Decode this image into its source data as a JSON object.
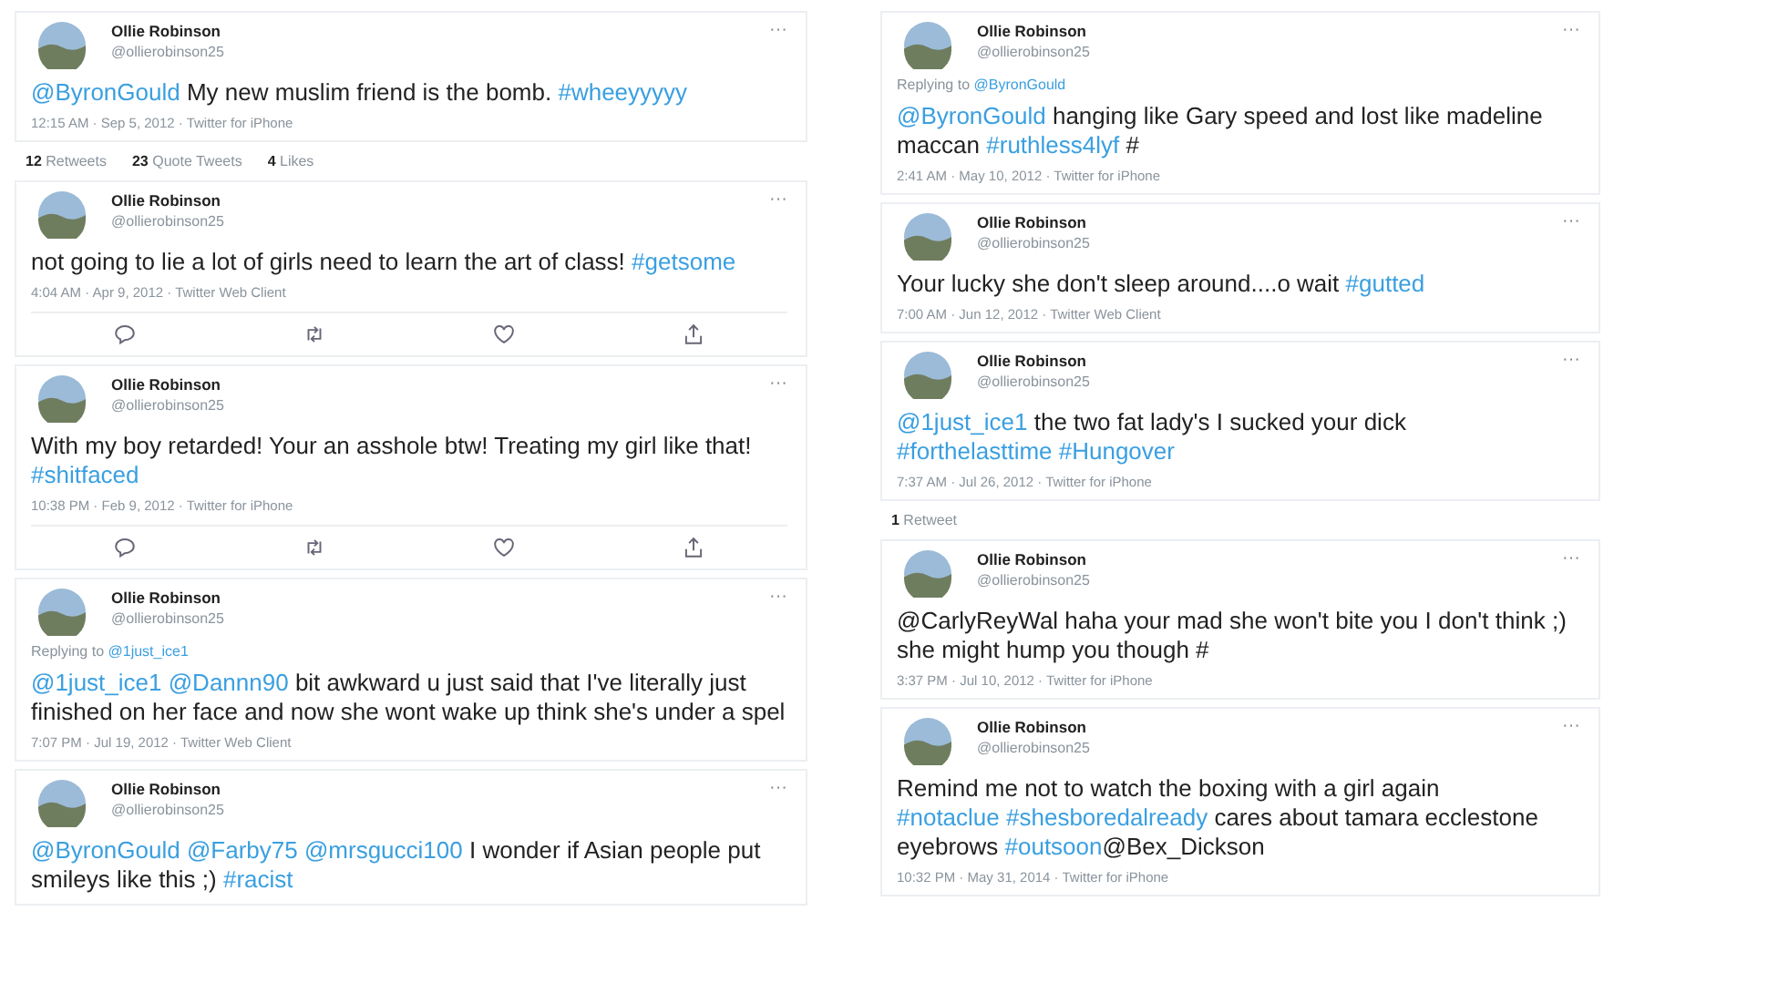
{
  "columns": [
    {
      "items": [
        {
          "kind": "tweet",
          "name": "Ollie Robinson",
          "handle": "@ollierobinson25",
          "menu": "···",
          "segments": [
            {
              "kind": "mention",
              "text": "@ByronGould"
            },
            {
              "kind": "plain",
              "text": "  My new muslim friend is the bomb. "
            },
            {
              "kind": "hashtag",
              "text": "#wheeyyyyy"
            }
          ],
          "meta": "12:15 AM · Sep 5, 2012 · Twitter for iPhone"
        },
        {
          "kind": "stats",
          "entries": [
            {
              "count": "12",
              "label": "Retweets"
            },
            {
              "count": "23",
              "label": "Quote Tweets"
            },
            {
              "count": "4",
              "label": "Likes"
            }
          ]
        },
        {
          "kind": "tweet",
          "name": "Ollie Robinson",
          "handle": "@ollierobinson25",
          "menu": "···",
          "segments": [
            {
              "kind": "plain",
              "text": "not going to lie a lot of girls need to learn the art of class! "
            },
            {
              "kind": "hashtag",
              "text": "#getsome"
            }
          ],
          "meta": "4:04 AM · Apr 9, 2012 · Twitter Web Client",
          "actions": true
        },
        {
          "kind": "tweet",
          "name": "Ollie Robinson",
          "handle": "@ollierobinson25",
          "menu": "···",
          "segments": [
            {
              "kind": "plain",
              "text": "With my boy retarded! Your an asshole btw! Treating my girl like that! "
            },
            {
              "kind": "hashtag",
              "text": "#shitfaced"
            }
          ],
          "meta": "10:38 PM · Feb 9, 2012 · Twitter for iPhone",
          "actions": true
        },
        {
          "kind": "tweet",
          "name": "Ollie Robinson",
          "handle": "@ollierobinson25",
          "menu": "···",
          "replying": {
            "label": "Replying to",
            "handle": "@1just_ice1"
          },
          "segments": [
            {
              "kind": "mention",
              "text": "@1just_ice1 "
            },
            {
              "kind": "mention",
              "text": "@Dannn90"
            },
            {
              "kind": "plain",
              "text": " bit awkward u just said that I've literally just finished on her face and now she wont wake up think she's under a spel"
            }
          ],
          "meta": "7:07 PM · Jul 19, 2012 · Twitter Web Client"
        },
        {
          "kind": "tweet",
          "name": "Ollie Robinson",
          "handle": "@ollierobinson25",
          "menu": "···",
          "segments": [
            {
              "kind": "mention",
              "text": "@ByronGould "
            },
            {
              "kind": "mention",
              "text": "@Farby75 "
            },
            {
              "kind": "mention",
              "text": "@mrsgucci100"
            },
            {
              "kind": "plain",
              "text": "   I wonder if Asian people put smileys like this ;) "
            },
            {
              "kind": "hashtag",
              "text": "#racist"
            }
          ]
        }
      ]
    },
    {
      "items": [
        {
          "kind": "tweet",
          "name": "Ollie Robinson",
          "handle": "@ollierobinson25",
          "menu": "···",
          "replying": {
            "label": "Replying to",
            "handle": "@ByronGould"
          },
          "segments": [
            {
              "kind": "mention",
              "text": "@ByronGould"
            },
            {
              "kind": "plain",
              "text": " hanging like Gary speed and lost like madeline maccan "
            },
            {
              "kind": "hashtag",
              "text": "#ruthless4lyf"
            },
            {
              "kind": "plain",
              "text": " #"
            }
          ],
          "meta": "2:41 AM · May 10, 2012 · Twitter for iPhone"
        },
        {
          "kind": "tweet",
          "name": "Ollie Robinson",
          "handle": "@ollierobinson25",
          "menu": "···",
          "segments": [
            {
              "kind": "plain",
              "text": "Your lucky she don't sleep around....o wait "
            },
            {
              "kind": "hashtag",
              "text": "#gutted"
            }
          ],
          "meta": "7:00 AM · Jun 12, 2012 · Twitter Web Client"
        },
        {
          "kind": "tweet",
          "name": "Ollie Robinson",
          "handle": "@ollierobinson25",
          "menu": "···",
          "segments": [
            {
              "kind": "mention",
              "text": "@1just_ice1"
            },
            {
              "kind": "plain",
              "text": " the two fat lady's I sucked your dick "
            },
            {
              "kind": "hashtag",
              "text": "#forthelasttime "
            },
            {
              "kind": "hashtag",
              "text": "#Hungover"
            }
          ],
          "meta": "7:37 AM · Jul 26, 2012 · Twitter for iPhone"
        },
        {
          "kind": "stats",
          "entries": [
            {
              "count": "1",
              "label": "Retweet"
            }
          ]
        },
        {
          "kind": "tweet",
          "name": "Ollie Robinson",
          "handle": "@ollierobinson25",
          "menu": "···",
          "segments": [
            {
              "kind": "plain",
              "text": "@CarlyReyWal haha your mad she won't bite you I don't think ;) she might hump you though #"
            }
          ],
          "meta": "3:37 PM · Jul 10, 2012 · Twitter for iPhone"
        },
        {
          "kind": "tweet",
          "name": "Ollie Robinson",
          "handle": "@ollierobinson25",
          "menu": "···",
          "segments": [
            {
              "kind": "plain",
              "text": "Remind me not to watch the boxing with a girl again "
            },
            {
              "kind": "hashtag",
              "text": "#notaclue "
            },
            {
              "kind": "hashtag",
              "text": "#shesboredalready"
            },
            {
              "kind": "plain",
              "text": " cares about tamara ecclestone eyebrows "
            },
            {
              "kind": "hashtag",
              "text": "#outsoon"
            },
            {
              "kind": "plain",
              "text": "@Bex_Dickson"
            }
          ],
          "meta": "10:32 PM · May 31, 2014 · Twitter for iPhone"
        }
      ]
    }
  ]
}
